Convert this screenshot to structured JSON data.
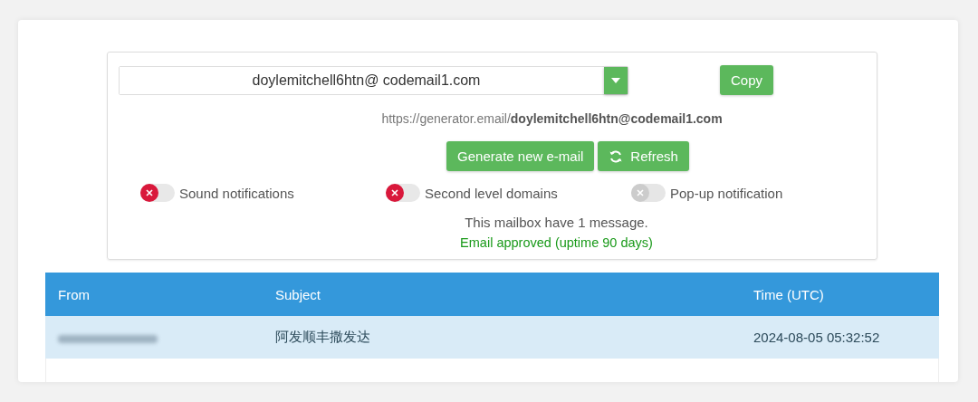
{
  "email_field": {
    "value": "doylemitchell6htn@ codemail1.com"
  },
  "copy_button": "Copy",
  "mailbox_link": {
    "prefix": "https://generator.email/",
    "address": "doylemitchell6htn@codemail1.com"
  },
  "buttons": [
    {
      "label": "Generate new e-mail",
      "kind": "plain"
    },
    {
      "label": "Refresh",
      "kind": "refresh"
    }
  ],
  "toggles": [
    {
      "label": "Sound notifications",
      "on": false,
      "disabled": false
    },
    {
      "label": "Second level domains",
      "on": false,
      "disabled": false
    },
    {
      "label": "Pop-up notification",
      "on": false,
      "disabled": true
    }
  ],
  "message_count": "This mailbox have 1 message.",
  "approval": "Email approved (uptime 90 days)",
  "table": {
    "columns": [
      "From",
      "Subject",
      "Time (UTC)"
    ],
    "rows": [
      {
        "from_blurred": true,
        "subject": "阿发顺丰撒发达",
        "time": "2024-08-05 05:32:52",
        "selected": true
      }
    ]
  }
}
